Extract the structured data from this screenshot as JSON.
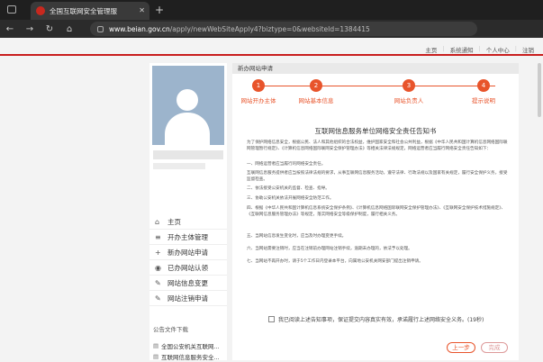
{
  "browser": {
    "tab_title": "全国互联网安全管理服",
    "url_domain": "www.beian.gov.cn",
    "url_path": "/apply/newWebSiteApply4?biztype=0&websiteId=1384415"
  },
  "topnav": [
    "主页",
    "系统通知",
    "个人中心",
    "注销"
  ],
  "breadcrumb": "新办网站申请",
  "steps": [
    {
      "num": "1",
      "label": "网站开办主体"
    },
    {
      "num": "2",
      "label": "网站基本信息"
    },
    {
      "num": "3",
      "label": "网站负责人"
    },
    {
      "num": "4",
      "label": "提示说明"
    }
  ],
  "menu": [
    {
      "icon": "⌂",
      "label": "主页"
    },
    {
      "icon": "≡",
      "label": "开办主体管理"
    },
    {
      "icon": "+",
      "label": "新办网站申请"
    },
    {
      "icon": "◉",
      "label": "已办网站认领"
    },
    {
      "icon": "✎",
      "label": "网站信息变更"
    },
    {
      "icon": "✎",
      "label": "网站注销申请"
    }
  ],
  "docs_caption": "公告文件下载",
  "docs": [
    "全国公安机关互联网...",
    "互联网信息服务安全..."
  ],
  "doc_title": "互联网信息服务单位网络安全责任告知书",
  "paragraphs": [
    "为了保护网络信息安全，根据公民、法人和其他组织的合法权益，维护国家安全和社会公共利益，根据《中华人民共和国计算机信息网络国际联网管理暂行规定》、《计算机信息网络国际联网安全保护管理办法》等相关法律法规规定，网络运营者应当履行网络安全责任告知如下：",
    "一、网络运营者应当履行的网络安全责任。",
    "互联网信息服务提供者应当按照法律法规的要求，从事互联网信息服务活动，遵守法律、行政法规以及国家有关规定，履行安全保护义务，接受监督检查。",
    "二、依法接受公安机关的监督、检查、指导。",
    "三、协助公安机关依法开展网络安全防范工作。",
    "四、根据《中华人民共和国计算机信息系统安全保护条例》、《计算机信息网络国际联网安全保护管理办法》、《互联网安全保护技术措施规定》、《互联网信息服务管理办法》等规定，落实网络安全等级保护制度，履行相关义务。",
    "五、当网站信息发生变化时，应当及时办理变更手续。",
    "六、当网站需要注销时，应当在注销前办理网站注销手续，逾期未办理的，依法予以处理。",
    "七、当网站不再开办时，请于5个工作日内登录本平台，向属地公安机关网安部门提出注销申请。"
  ],
  "agree_text": "我已阅读上述告知事项，保证提交内容真实有效，承诺履行上述网络安全义务。(19秒)",
  "buttons": {
    "prev": "上一步",
    "done": "完成"
  }
}
